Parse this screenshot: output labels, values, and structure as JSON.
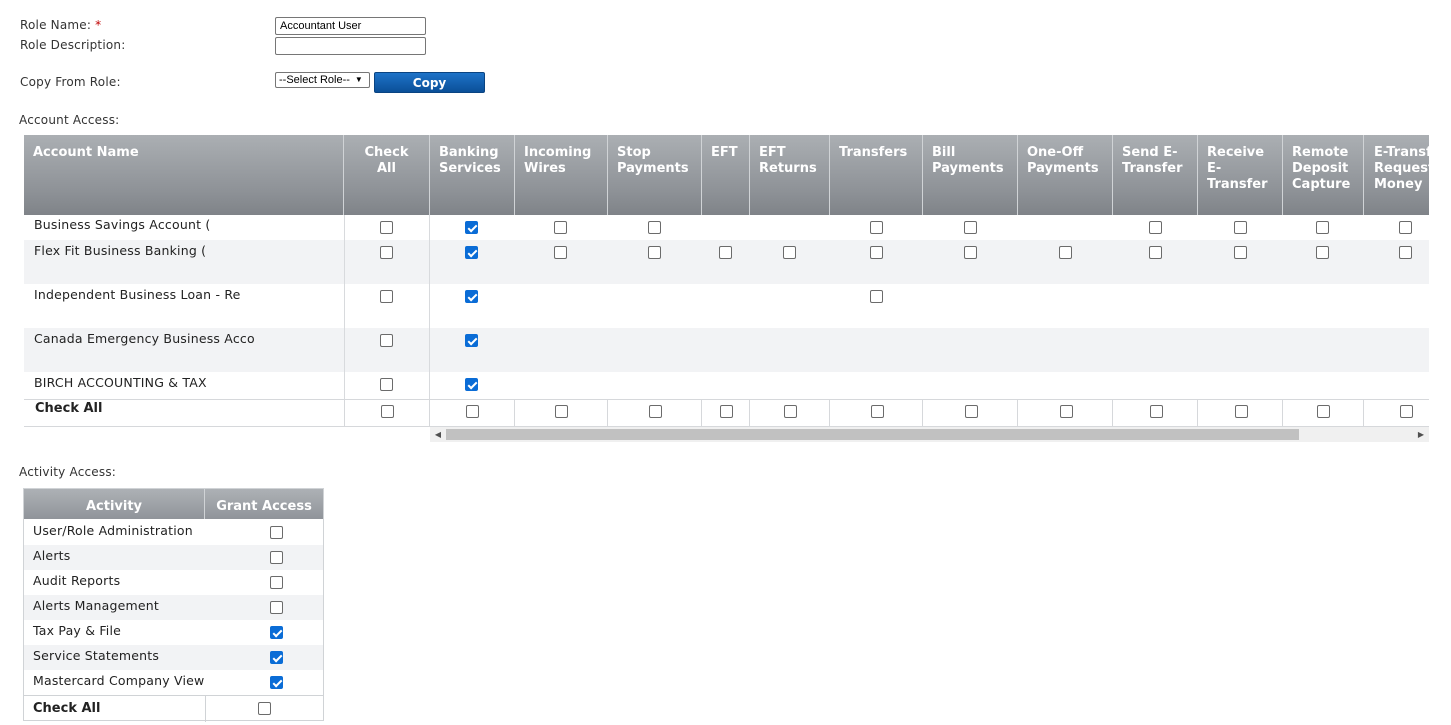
{
  "role_form": {
    "role_name_label": "Role Name:",
    "required_mark": "*",
    "role_name_value": "Accountant User",
    "role_description_label": "Role Description:",
    "role_description_value": "",
    "copy_from_label": "Copy From Role:",
    "copy_from_selected": "--Select Role--",
    "copy_button": "Copy"
  },
  "account_access": {
    "section_label": "Account Access:",
    "columns": [
      "Account Name",
      "Check All",
      "Banking Services",
      "Incoming Wires",
      "Stop Payments",
      "EFT",
      "EFT Returns",
      "Transfers",
      "Bill Payments",
      "One-Off Payments",
      "Send E-Transfer",
      "Receive E-Transfer",
      "Remote Deposit Capture",
      "E-Transfer Request Money"
    ],
    "rows": [
      {
        "name": "Business Savings Account (",
        "cells": [
          false,
          true,
          false,
          false,
          null,
          null,
          false,
          false,
          null,
          false,
          false,
          false,
          false
        ]
      },
      {
        "name": "Flex Fit Business Banking (",
        "cells": [
          false,
          true,
          false,
          false,
          false,
          false,
          false,
          false,
          false,
          false,
          false,
          false,
          false
        ]
      },
      {
        "name": "Independent Business Loan - Re",
        "cells": [
          false,
          true,
          null,
          null,
          null,
          null,
          false,
          null,
          null,
          null,
          null,
          null,
          null
        ]
      },
      {
        "name": "Canada Emergency Business Acco",
        "cells": [
          false,
          true,
          null,
          null,
          null,
          null,
          null,
          null,
          null,
          null,
          null,
          null,
          null
        ]
      },
      {
        "name": "BIRCH ACCOUNTING & TAX",
        "cells": [
          false,
          true,
          null,
          null,
          null,
          null,
          null,
          null,
          null,
          null,
          null,
          null,
          null
        ]
      }
    ],
    "footer_label": "Check All",
    "footer_cells": [
      false,
      false,
      false,
      false,
      false,
      false,
      false,
      false,
      false,
      false,
      false,
      false,
      false
    ]
  },
  "activity_access": {
    "section_label": "Activity Access:",
    "columns": [
      "Activity",
      "Grant Access"
    ],
    "rows": [
      {
        "name": "User/Role Administration",
        "granted": false
      },
      {
        "name": "Alerts",
        "granted": false
      },
      {
        "name": "Audit Reports",
        "granted": false
      },
      {
        "name": "Alerts Management",
        "granted": false
      },
      {
        "name": "Tax Pay & File",
        "granted": true
      },
      {
        "name": "Service Statements",
        "granted": true
      },
      {
        "name": "Mastercard Company View",
        "granted": true
      }
    ],
    "footer_label": "Check All",
    "footer_checked": false
  },
  "colors": {
    "header_gray": "#8e9297",
    "button_blue": "#0b4f98",
    "checkbox_blue": "#0a6cd6",
    "required_red": "#c00000"
  }
}
